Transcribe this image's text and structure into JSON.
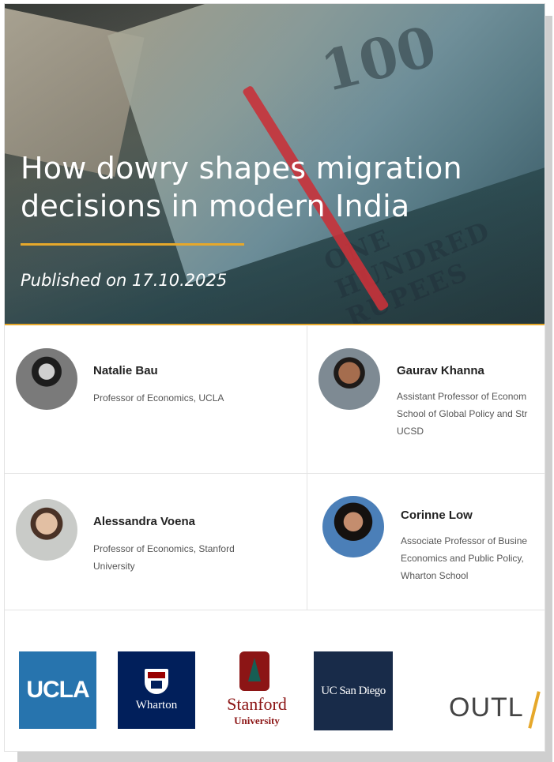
{
  "hero": {
    "title": "How dowry shapes migration decisions in modern India",
    "published": "Published on 17.10.2025",
    "note_denomination": "100",
    "note_text": "ONE HUNDRED RUPEES",
    "accent_color": "#e6a82b"
  },
  "authors": [
    {
      "name": "Natalie Bau",
      "role": "Professor of Economics, UCLA",
      "avatar": "avatar-natalie-bau"
    },
    {
      "name": "Gaurav Khanna",
      "role": "Assistant Professor of Econom\nSchool of Global Policy and Str\nUCSD",
      "avatar": "avatar-gaurav-khanna"
    },
    {
      "name": "Alessandra Voena",
      "role": "Professor of Economics, Stanford\nUniversity",
      "avatar": "avatar-alessandra-voena"
    },
    {
      "name": "Corinne Low",
      "role": "Associate Professor of Busine\nEconomics and Public Policy,\nWharton School",
      "avatar": "avatar-corinne-low"
    }
  ],
  "logos": {
    "ucla": "UCLA",
    "wharton": "Wharton",
    "stanford": "Stanford",
    "stanford_sub": "University",
    "ucsd": "UC San Diego",
    "outlier": "OUTL"
  }
}
